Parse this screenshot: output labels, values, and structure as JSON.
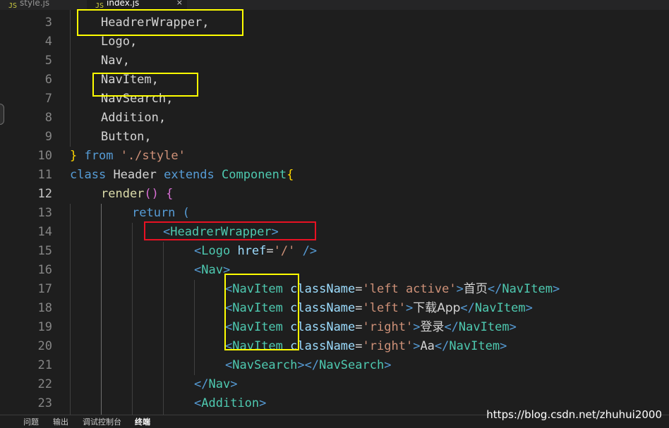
{
  "tabs": [
    {
      "label": "style.js",
      "icon": "JS"
    },
    {
      "label": "index.js",
      "icon": "JS",
      "close": "×"
    }
  ],
  "lines": [
    {
      "no": "3",
      "tokens": [
        {
          "t": "HeadrerWrapper,",
          "c": "plain"
        }
      ]
    },
    {
      "no": "4",
      "tokens": [
        {
          "t": "Logo,",
          "c": "plain"
        }
      ]
    },
    {
      "no": "5",
      "tokens": [
        {
          "t": "Nav,",
          "c": "plain"
        }
      ]
    },
    {
      "no": "6",
      "tokens": [
        {
          "t": "NavItem,",
          "c": "plain"
        }
      ]
    },
    {
      "no": "7",
      "tokens": [
        {
          "t": "NavSearch,",
          "c": "plain"
        }
      ]
    },
    {
      "no": "8",
      "tokens": [
        {
          "t": "Addition,",
          "c": "plain"
        }
      ]
    },
    {
      "no": "9",
      "tokens": [
        {
          "t": "Button,",
          "c": "plain"
        }
      ]
    },
    {
      "no": "10",
      "tokens": [
        {
          "t": "}",
          "c": "brace"
        },
        {
          "t": " ",
          "c": "plain"
        },
        {
          "t": "from",
          "c": "kw"
        },
        {
          "t": " ",
          "c": "plain"
        },
        {
          "t": "'./style'",
          "c": "str"
        }
      ]
    },
    {
      "no": "11",
      "tokens": [
        {
          "t": "class",
          "c": "kw"
        },
        {
          "t": " ",
          "c": "plain"
        },
        {
          "t": "Header",
          "c": "plain"
        },
        {
          "t": " ",
          "c": "plain"
        },
        {
          "t": "extends",
          "c": "kw"
        },
        {
          "t": " ",
          "c": "plain"
        },
        {
          "t": "Component",
          "c": "cls"
        },
        {
          "t": "{",
          "c": "brace"
        }
      ]
    },
    {
      "no": "12",
      "tokens": [
        {
          "t": "render",
          "c": "fn"
        },
        {
          "t": "()",
          "c": "paren"
        },
        {
          "t": " ",
          "c": "plain"
        },
        {
          "t": "{",
          "c": "paren"
        }
      ]
    },
    {
      "no": "13",
      "tokens": [
        {
          "t": "return",
          "c": "kw"
        },
        {
          "t": " ",
          "c": "plain"
        },
        {
          "t": "(",
          "c": "kw"
        }
      ]
    },
    {
      "no": "14",
      "tokens": [
        {
          "t": "<",
          "c": "tag"
        },
        {
          "t": "HeadrerWrapper",
          "c": "tname"
        },
        {
          "t": ">",
          "c": "tag"
        }
      ]
    },
    {
      "no": "15",
      "tokens": [
        {
          "t": "<",
          "c": "tag"
        },
        {
          "t": "Logo",
          "c": "tname"
        },
        {
          "t": " ",
          "c": "plain"
        },
        {
          "t": "href",
          "c": "attr"
        },
        {
          "t": "=",
          "c": "plain"
        },
        {
          "t": "'/'",
          "c": "str"
        },
        {
          "t": " ",
          "c": "plain"
        },
        {
          "t": "/>",
          "c": "tag"
        }
      ]
    },
    {
      "no": "16",
      "tokens": [
        {
          "t": "<",
          "c": "tag"
        },
        {
          "t": "Nav",
          "c": "tname"
        },
        {
          "t": ">",
          "c": "tag"
        }
      ]
    },
    {
      "no": "17",
      "tokens": [
        {
          "t": "<",
          "c": "tag"
        },
        {
          "t": "NavItem",
          "c": "tname"
        },
        {
          "t": " ",
          "c": "plain"
        },
        {
          "t": "className",
          "c": "attr"
        },
        {
          "t": "=",
          "c": "plain"
        },
        {
          "t": "'left active'",
          "c": "str"
        },
        {
          "t": ">",
          "c": "tag"
        },
        {
          "t": "首页",
          "c": "txt"
        },
        {
          "t": "</",
          "c": "tag"
        },
        {
          "t": "NavItem",
          "c": "tname"
        },
        {
          "t": ">",
          "c": "tag"
        }
      ]
    },
    {
      "no": "18",
      "tokens": [
        {
          "t": "<",
          "c": "tag"
        },
        {
          "t": "NavItem",
          "c": "tname"
        },
        {
          "t": " ",
          "c": "plain"
        },
        {
          "t": "className",
          "c": "attr"
        },
        {
          "t": "=",
          "c": "plain"
        },
        {
          "t": "'left'",
          "c": "str"
        },
        {
          "t": ">",
          "c": "tag"
        },
        {
          "t": "下载App",
          "c": "txt"
        },
        {
          "t": "</",
          "c": "tag"
        },
        {
          "t": "NavItem",
          "c": "tname"
        },
        {
          "t": ">",
          "c": "tag"
        }
      ]
    },
    {
      "no": "19",
      "tokens": [
        {
          "t": "<",
          "c": "tag"
        },
        {
          "t": "NavItem",
          "c": "tname"
        },
        {
          "t": " ",
          "c": "plain"
        },
        {
          "t": "className",
          "c": "attr"
        },
        {
          "t": "=",
          "c": "plain"
        },
        {
          "t": "'right'",
          "c": "str"
        },
        {
          "t": ">",
          "c": "tag"
        },
        {
          "t": "登录",
          "c": "txt"
        },
        {
          "t": "</",
          "c": "tag"
        },
        {
          "t": "NavItem",
          "c": "tname"
        },
        {
          "t": ">",
          "c": "tag"
        }
      ]
    },
    {
      "no": "20",
      "tokens": [
        {
          "t": "<",
          "c": "tag"
        },
        {
          "t": "NavItem",
          "c": "tname"
        },
        {
          "t": " ",
          "c": "plain"
        },
        {
          "t": "className",
          "c": "attr"
        },
        {
          "t": "=",
          "c": "plain"
        },
        {
          "t": "'right'",
          "c": "str"
        },
        {
          "t": ">",
          "c": "tag"
        },
        {
          "t": "Aa",
          "c": "plain"
        },
        {
          "t": "</",
          "c": "tag"
        },
        {
          "t": "NavItem",
          "c": "tname"
        },
        {
          "t": ">",
          "c": "tag"
        }
      ]
    },
    {
      "no": "21",
      "tokens": [
        {
          "t": "<",
          "c": "tag"
        },
        {
          "t": "NavSearch",
          "c": "tname"
        },
        {
          "t": "></",
          "c": "tag"
        },
        {
          "t": "NavSearch",
          "c": "tname"
        },
        {
          "t": ">",
          "c": "tag"
        }
      ]
    },
    {
      "no": "22",
      "tokens": [
        {
          "t": "</",
          "c": "tag"
        },
        {
          "t": "Nav",
          "c": "tname"
        },
        {
          "t": ">",
          "c": "tag"
        }
      ]
    },
    {
      "no": "23",
      "tokens": [
        {
          "t": "<",
          "c": "tag"
        },
        {
          "t": "Addition",
          "c": "tname"
        },
        {
          "t": ">",
          "c": "tag"
        }
      ]
    }
  ],
  "panel_tabs": [
    "问题",
    "输出",
    "调试控制台",
    "终端"
  ],
  "watermark": "https://blog.csdn.net/zhuhui2000",
  "colors": {
    "editor_bg": "#1e1e1e",
    "highlight_yellow": "#ffff00",
    "highlight_red": "#e81123"
  }
}
